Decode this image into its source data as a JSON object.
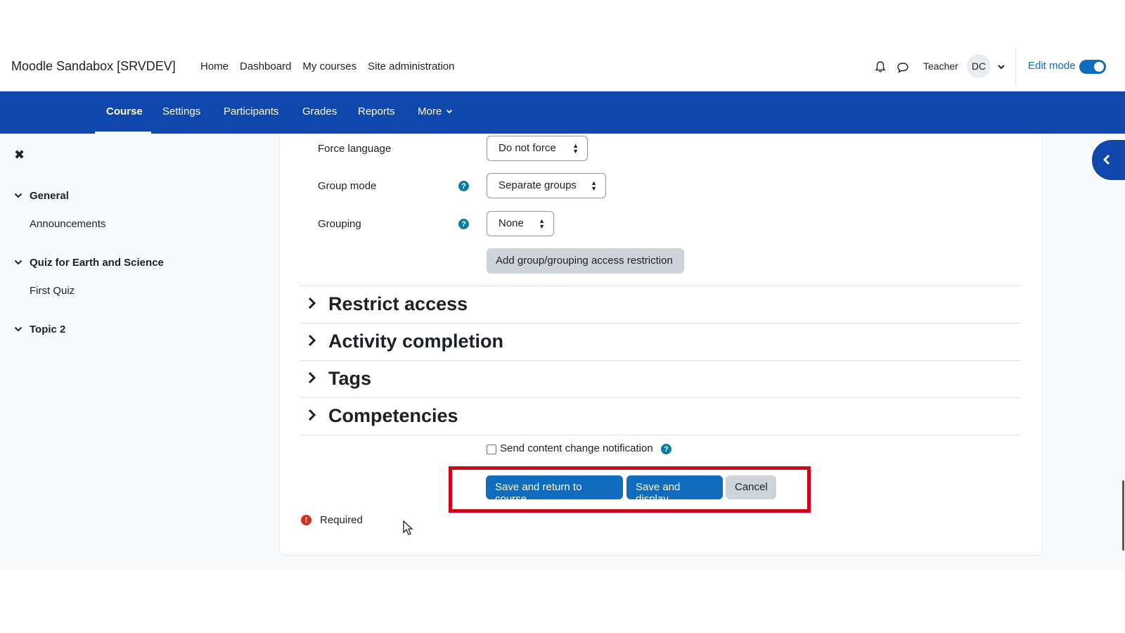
{
  "header": {
    "site_name": "Moodle Sandabox [SRVDEV]",
    "nav": [
      "Home",
      "Dashboard",
      "My courses",
      "Site administration"
    ],
    "role": "Teacher",
    "avatar_initials": "DC",
    "edit_mode_label": "Edit mode",
    "edit_mode_on": true
  },
  "secondary_nav": {
    "tabs": [
      "Course",
      "Settings",
      "Participants",
      "Grades",
      "Reports",
      "More"
    ],
    "active": "Course"
  },
  "course_index": {
    "sections": [
      {
        "title": "General",
        "activities": [
          "Announcements"
        ]
      },
      {
        "title": "Quiz for Earth and Science",
        "activities": [
          "First Quiz"
        ]
      },
      {
        "title": "Topic 2",
        "activities": []
      }
    ]
  },
  "form": {
    "force_language": {
      "label": "Force language",
      "value": "Do not force"
    },
    "group_mode": {
      "label": "Group mode",
      "value": "Separate groups"
    },
    "grouping": {
      "label": "Grouping",
      "value": "None"
    },
    "add_restriction_label": "Add group/grouping access restriction",
    "collapsed_sections": [
      "Restrict access",
      "Activity completion",
      "Tags",
      "Competencies"
    ],
    "notification_label": "Send content change notification",
    "notification_checked": false,
    "buttons": {
      "save_return": "Save and return to course",
      "save_display": "Save and display",
      "cancel": "Cancel"
    },
    "required_label": "Required"
  },
  "colors": {
    "brand_blue": "#0f47ad",
    "primary": "#0f6cbf",
    "highlight": "#d0021b"
  }
}
